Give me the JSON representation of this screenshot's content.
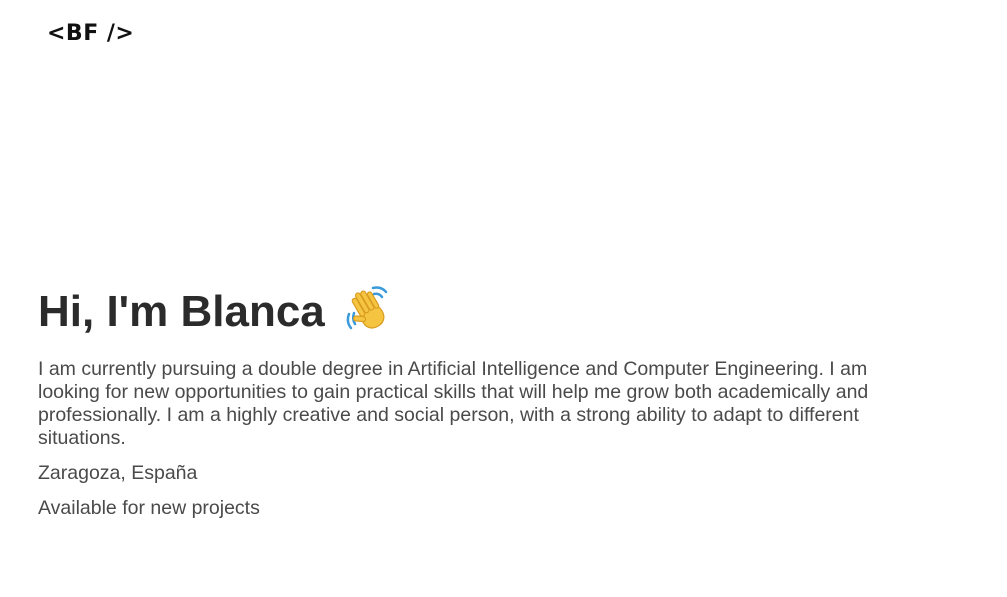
{
  "header": {
    "logo_text": "<BF />"
  },
  "hero": {
    "greeting": "Hi, I'm Blanca",
    "greeting_icon": "waving-hand-icon",
    "description": "I am currently pursuing a double degree in Artificial Intelligence and Computer Engineering. I am looking for new opportunities to gain practical skills that will help me grow both academically and professionally. I am a highly creative and social person, with a strong ability to adapt to different situations.",
    "location": "Zaragoza, España",
    "availability": "Available for new projects"
  },
  "colors": {
    "background": "#ffffff",
    "heading": "#2b2b2b",
    "body_text": "#4a4a4a",
    "logo": "#111111",
    "wave_yellow": "#f5c542",
    "wave_motion": "#3b9ad9"
  }
}
